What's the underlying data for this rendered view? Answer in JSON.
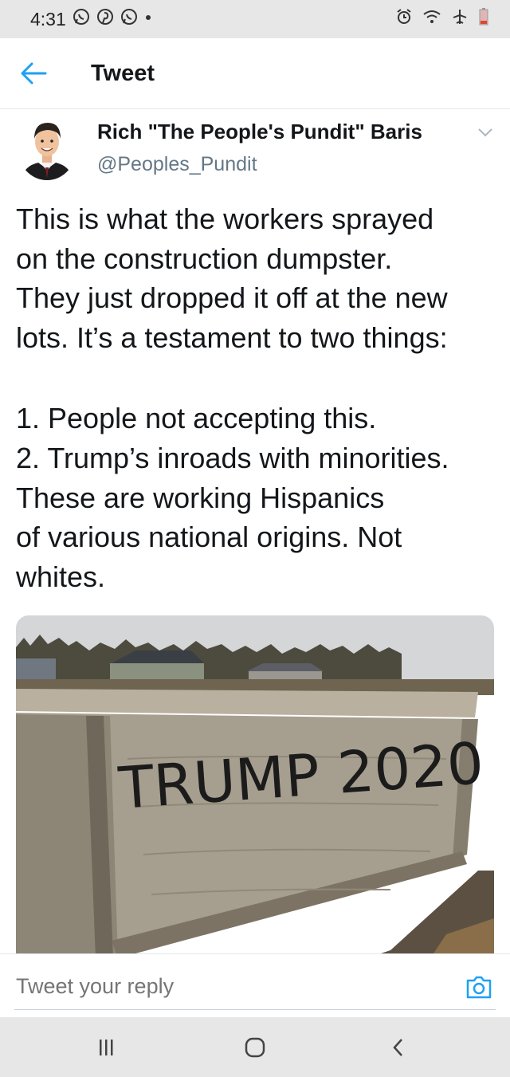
{
  "status_bar": {
    "time": "4:31",
    "notification_icons": [
      "whatsapp-icon",
      "pinterest-icon",
      "whatsapp-icon",
      "dot-icon"
    ],
    "system_icons": [
      "alarm-icon",
      "wifi-icon",
      "airplane-mode-icon",
      "battery-low-icon"
    ]
  },
  "header": {
    "back_icon": "arrow-left-icon",
    "title": "Tweet"
  },
  "tweet": {
    "author_name": "Rich \"The People's Pundit\" Baris",
    "author_handle": "@Peoples_Pundit",
    "text_lines": [
      "This is what the workers sprayed",
      "on the construction dumpster.",
      "They just dropped it off at the new",
      "lots. It’s a testament to two things:"
    ],
    "list_lines": [
      "1. People not accepting this.",
      "2. Trump’s inroads with minorities.",
      "These are working Hispanics",
      "of various national origins. Not",
      "whites."
    ],
    "photo_graffiti": "TRUMP 2020"
  },
  "reply": {
    "placeholder": "Tweet your reply",
    "camera_icon": "camera-icon"
  },
  "nav_bar": {
    "buttons": [
      "recents-icon",
      "home-icon",
      "back-icon"
    ]
  },
  "colors": {
    "accent": "#1da1f2",
    "text": "#14171a",
    "secondary": "#657786",
    "system_bar": "#e7e7e7"
  }
}
